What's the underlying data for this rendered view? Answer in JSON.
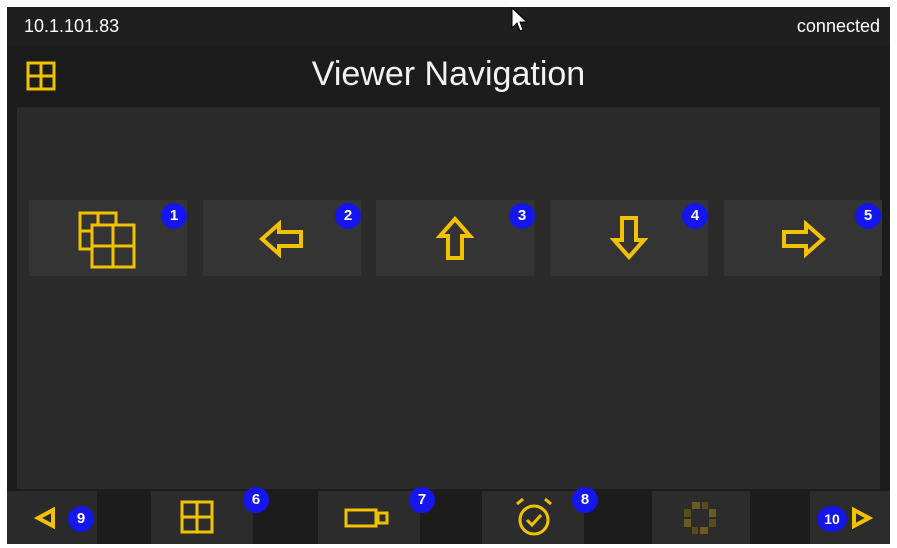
{
  "status": {
    "ip_address": "10.1.101.83",
    "connection": "connected"
  },
  "header": {
    "title": "Viewer Navigation",
    "home_icon": "grid-icon"
  },
  "nav_buttons": [
    {
      "icon": "layered-grid-icon",
      "badge": "1"
    },
    {
      "icon": "arrow-left-icon",
      "badge": "2"
    },
    {
      "icon": "arrow-up-icon",
      "badge": "3"
    },
    {
      "icon": "arrow-down-icon",
      "badge": "4"
    },
    {
      "icon": "arrow-right-icon",
      "badge": "5"
    }
  ],
  "bottom_bar": {
    "prev": {
      "icon": "triangle-left-icon",
      "badge": "9"
    },
    "items": [
      {
        "icon": "grid-icon",
        "badge": "6"
      },
      {
        "icon": "camera-icon",
        "badge": "7"
      },
      {
        "icon": "alarm-clock-icon",
        "badge": "8"
      },
      {
        "icon": "refresh-icon",
        "badge": ""
      }
    ],
    "next": {
      "icon": "triangle-right-icon",
      "badge": "10"
    }
  },
  "colors": {
    "accent": "#f2c200",
    "badge": "#1515ee",
    "panel": "#2b2b2b",
    "button": "#343434"
  }
}
